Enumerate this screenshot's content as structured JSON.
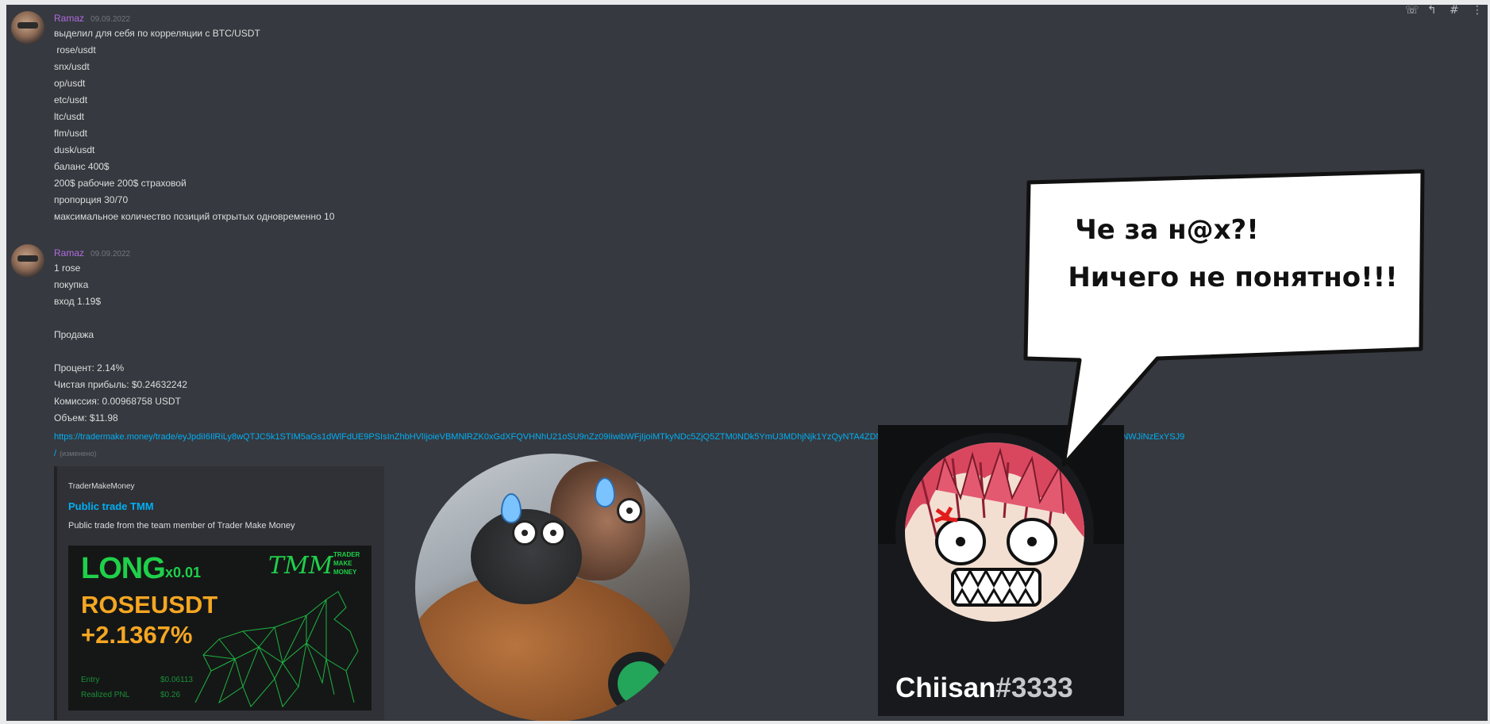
{
  "window": {
    "icons": [
      "phone-icon",
      "reply-icon",
      "hashtag-icon",
      "more-icon"
    ]
  },
  "messages": [
    {
      "username": "Ramaz",
      "date": "09.09.2022",
      "lines": [
        "выделил для себя по корреляции с BTC/USDT",
        " rose/usdt",
        "snx/usdt",
        "op/usdt",
        "etc/usdt",
        "ltc/usdt",
        "flm/usdt",
        "dusk/usdt"
      ]
    },
    {
      "username": "",
      "date": "",
      "lines": [
        "баланс 400$",
        "200$ рабочие 200$ страховой",
        "пропорция 30/70",
        "максимальное количество позиций открытых одновременно 10"
      ]
    },
    {
      "username": "Ramaz",
      "date": "09.09.2022",
      "lines": [
        "1 rose",
        "покупка",
        "вход 1.19$",
        "",
        "Продажа",
        "",
        "Процент: 2.14%",
        "Чистая прибыль: $0.24632242",
        "Комиссия: 0.00968758 USDT",
        "Объем: $11.98"
      ],
      "link": "https://tradermake.money/trade/eyJpdiI6IlRiLy8wQTJC5k1STIM5aGs1dWlFdUE9PSIsInZhbHVlIjoieVBMNlRZK0xGdXFQVHNhU21oSU9nZz09IiwibWFjIjoiMTkyNDc5ZjQ5ZTM0NDk5YmU3MDhjNjk1YzQyNTA4ZDNjMzA1ZjY2RmZDJlZGIxN2Q1ZjlzYTU5MTMyN2VlMWI2NWVlNWJiNzExYSJ9",
      "edited": "(изменено)",
      "embed": {
        "provider": "TraderMakeMoney",
        "title": "Public trade TMM",
        "description": "Public trade from the team member of Trader Make Money",
        "card": {
          "side": "LONG",
          "leverage": "x0.01",
          "pair": "ROSEUSDT",
          "percent": "+2.1367%",
          "brand_logo": "TMM",
          "brand_lines": [
            "TRADER",
            "MAKE",
            "MONEY"
          ],
          "entry_label": "Entry",
          "entry_value": "$0.06113",
          "pnl_label": "Realized PNL",
          "pnl_value": "$0.26"
        }
      }
    }
  ],
  "profile": {
    "name": "Chiisan",
    "discriminator": "#3333"
  },
  "speech_bubble": {
    "line1": "Че за н@х?!",
    "line2": "Ничего не понятно!!!"
  },
  "colors": {
    "background": "#36393f",
    "username": "#b06be0",
    "link": "#00aff4",
    "long": "#1fd04a",
    "pair": "#f5a623",
    "online": "#23a55a"
  }
}
